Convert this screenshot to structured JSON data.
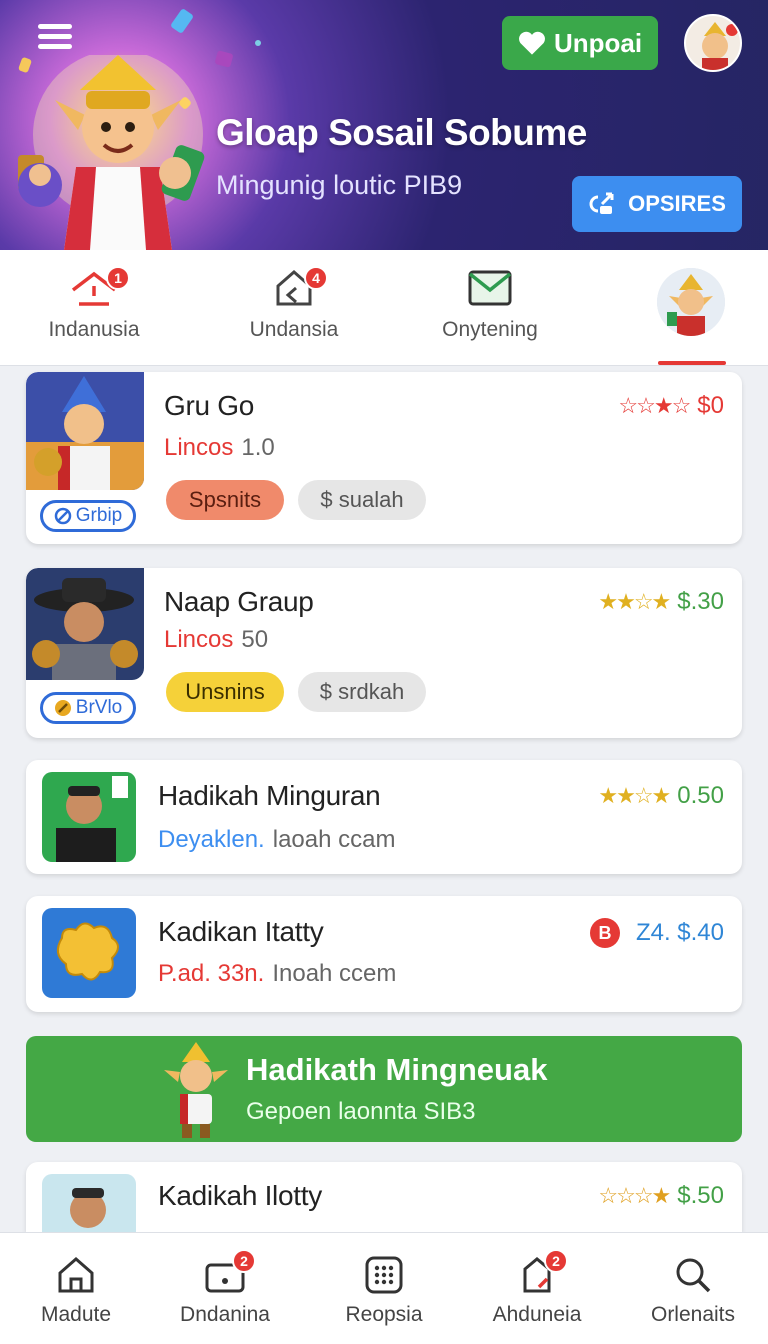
{
  "header": {
    "title": "Gloap Sosail Sobume",
    "subtitle": "Mingunig loutic PIB9",
    "upgrade_label": "Unpoai",
    "cta_label": "OPSIRES"
  },
  "tabs": [
    {
      "label": "Indanusia",
      "badge": "1",
      "icon": "home-alert-icon"
    },
    {
      "label": "Undansia",
      "badge": "4",
      "icon": "home-back-icon"
    },
    {
      "label": "Onytening",
      "badge": "",
      "icon": "mail-icon"
    },
    {
      "label": "",
      "badge": "",
      "icon": "profile-avatar"
    }
  ],
  "cards": [
    {
      "title": "Gru Go",
      "sub_a": "Lincos",
      "sub_b": "1.0",
      "tag1": "Spsnits",
      "tag2": "$ sualah",
      "price": "$0",
      "group": "Grbip",
      "stars": "☆☆★☆"
    },
    {
      "title": "Naap Graup",
      "sub_a": "Lincos",
      "sub_b": "50",
      "tag1": "Unsnins",
      "tag2": "$ srdkah",
      "price": "$.30",
      "group": "BrVlo",
      "stars": "★★☆★"
    },
    {
      "title": "Hadikah Minguran",
      "sub_a": "Deyaklen.",
      "sub_b": "laoah ccam",
      "price": "0.50",
      "stars": "★★☆★"
    },
    {
      "title": "Kadikan Itatty",
      "sub_a": "P.ad. 33n.",
      "sub_b": "Inoah ccem",
      "price": "Z4. $.40",
      "coin": "B"
    },
    {
      "title": "Kadikah Ilotty",
      "price": "$.50",
      "stars": "☆☆☆★"
    }
  ],
  "promo": {
    "title": "Hadikath Mingneuak",
    "subtitle": "Gepoen laonnta SIB3"
  },
  "bottom_nav": [
    {
      "label": "Madute",
      "badge": ""
    },
    {
      "label": "Dndanina",
      "badge": "2"
    },
    {
      "label": "Reopsia",
      "badge": ""
    },
    {
      "label": "Ahduneia",
      "badge": "2"
    },
    {
      "label": "Orlenaits",
      "badge": ""
    }
  ],
  "colors": {
    "accent_red": "#e53935",
    "green": "#3aa84a",
    "blue": "#3d8ef0",
    "price_red": "#e53935",
    "price_green": "#43a047",
    "price_blue": "#2f86d6"
  }
}
